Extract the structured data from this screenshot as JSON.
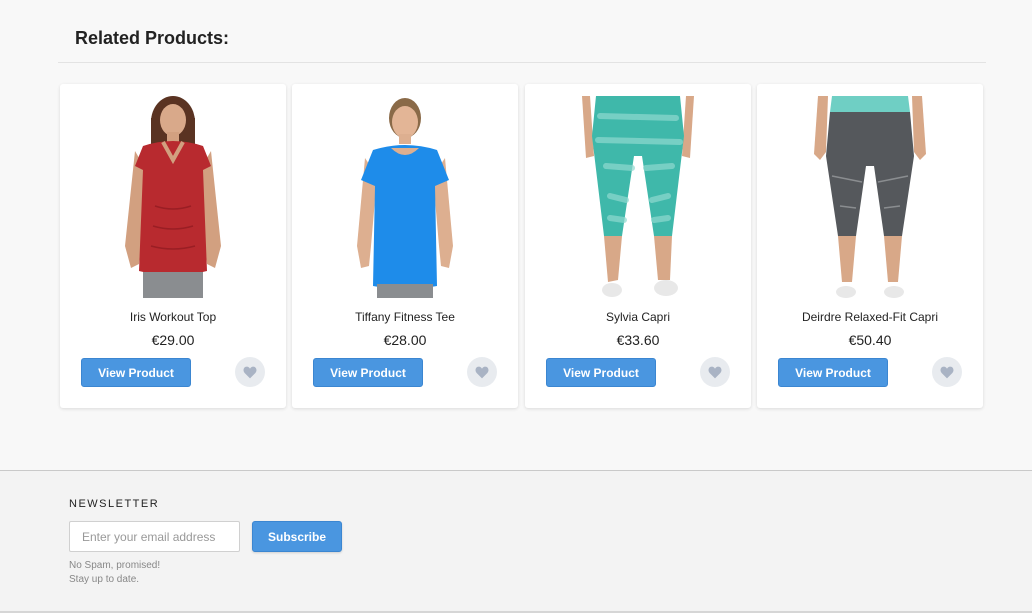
{
  "section": {
    "title": "Related Products:"
  },
  "products": [
    {
      "name": "Iris Workout Top",
      "price": "€29.00",
      "view_label": "View Product",
      "image_icon": "product-photo-iris-workout-top"
    },
    {
      "name": "Tiffany Fitness Tee",
      "price": "€28.00",
      "view_label": "View Product",
      "image_icon": "product-photo-tiffany-fitness-tee"
    },
    {
      "name": "Sylvia Capri",
      "price": "€33.60",
      "view_label": "View Product",
      "image_icon": "product-photo-sylvia-capri"
    },
    {
      "name": "Deirdre Relaxed-Fit Capri",
      "price": "€50.40",
      "view_label": "View Product",
      "image_icon": "product-photo-deirdre-capri"
    }
  ],
  "newsletter": {
    "title": "NEWSLETTER",
    "email_placeholder": "Enter your email address",
    "email_value": "",
    "subscribe_label": "Subscribe",
    "note_line1": "No Spam, promised!",
    "note_line2": "Stay up to date."
  },
  "colors": {
    "accent": "#4a96e0",
    "page_bg": "#f8f8f8",
    "footer_bg": "#f3f3f3",
    "heart_bg": "#e8ebef",
    "heart": "#a9b3c4"
  }
}
